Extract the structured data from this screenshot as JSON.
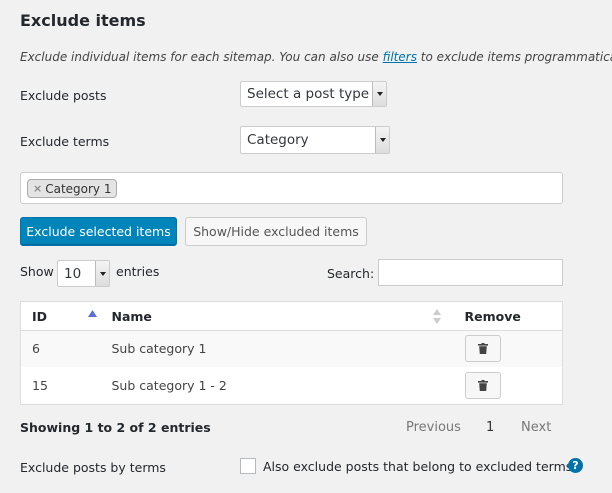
{
  "section": {
    "title": "Exclude items",
    "description_before": "Exclude individual items for each sitemap. You can also use ",
    "description_link": "filters",
    "description_after": " to exclude items programmatically."
  },
  "exclude_posts": {
    "label": "Exclude posts",
    "selected": "Select a post type"
  },
  "exclude_terms": {
    "label": "Exclude terms",
    "selected": "Category"
  },
  "selected_tags": [
    {
      "remove": "×",
      "label": "Category 1"
    }
  ],
  "buttons": {
    "exclude_selected": "Exclude selected items",
    "show_hide": "Show/Hide excluded items"
  },
  "table_controls": {
    "show_label": "Show",
    "entries_value": "10",
    "entries_label": "entries",
    "search_label": "Search:"
  },
  "table": {
    "headers": {
      "id": "ID",
      "name": "Name",
      "remove": "Remove"
    },
    "rows": [
      {
        "id": "6",
        "name": "Sub category 1"
      },
      {
        "id": "15",
        "name": "Sub category 1 - 2"
      }
    ]
  },
  "pagination": {
    "info": "Showing 1 to 2 of 2 entries",
    "previous": "Previous",
    "current": "1",
    "next": "Next"
  },
  "exclude_by_terms": {
    "label": "Exclude posts by terms",
    "checkbox_label": "Also exclude posts that belong to excluded terms.",
    "checked": false,
    "help_glyph": "?"
  },
  "colors": {
    "primary": "#0085ba",
    "link": "#0073aa",
    "sort_arrow": "#5b6fd6"
  }
}
